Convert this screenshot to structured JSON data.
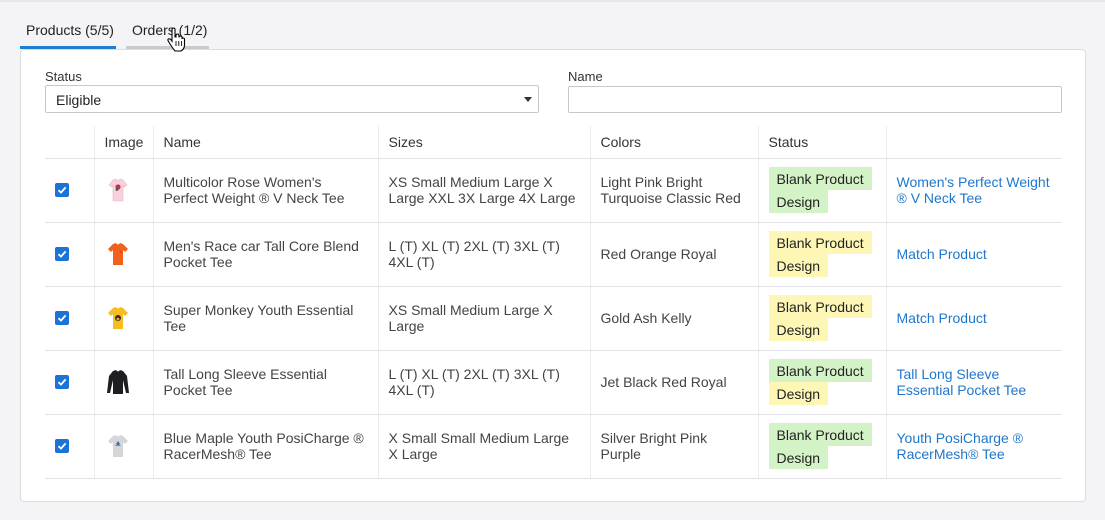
{
  "tabs": [
    {
      "label": "Products (5/5)",
      "active": true
    },
    {
      "label": "Orders (1/2)",
      "active": false
    }
  ],
  "filters": {
    "status_label": "Status",
    "status_value": "Eligible",
    "name_label": "Name",
    "name_value": ""
  },
  "table": {
    "headers": [
      "",
      "Image",
      "Name",
      "Sizes",
      "Colors",
      "Status",
      ""
    ],
    "rows": [
      {
        "checked": true,
        "image": "pink-rose-tee-icon",
        "name": "Multicolor Rose Women's Perfect Weight ® V Neck Tee",
        "sizes": "XS Small Medium Large X Large XXL 3X Large 4X Large",
        "colors": "Light Pink Bright Turquoise Classic Red",
        "status": [
          {
            "text": "Blank Product",
            "color": "#d3f2c6"
          },
          {
            "text": "Design",
            "color": "#d3f2c6"
          }
        ],
        "link": "Women's Perfect Weight ® V Neck Tee"
      },
      {
        "checked": true,
        "image": "orange-tee-icon",
        "name": "Men's Race car Tall Core Blend Pocket Tee",
        "sizes": "L (T) XL (T) 2XL (T) 3XL (T) 4XL (T)",
        "colors": "Red Orange Royal",
        "status": [
          {
            "text": "Blank Product",
            "color": "#fdf6b4"
          },
          {
            "text": "Design",
            "color": "#fdf6b4"
          }
        ],
        "link": "Match Product"
      },
      {
        "checked": true,
        "image": "yellow-monkey-tee-icon",
        "name": "Super Monkey Youth Essential Tee",
        "sizes": "XS Small Medium Large X Large",
        "colors": "Gold Ash Kelly",
        "status": [
          {
            "text": "Blank Product",
            "color": "#fdf6b4"
          },
          {
            "text": "Design",
            "color": "#fdf6b4"
          }
        ],
        "link": "Match Product"
      },
      {
        "checked": true,
        "image": "black-long-sleeve-icon",
        "name": "Tall Long Sleeve Essential Pocket Tee",
        "sizes": "L (T) XL (T) 2XL (T) 3XL (T) 4XL (T)",
        "colors": "Jet Black Red Royal",
        "status": [
          {
            "text": "Blank Product",
            "color": "#d3f2c6"
          },
          {
            "text": "Design",
            "color": "#fdf6b4"
          }
        ],
        "link": "Tall Long Sleeve Essential Pocket Tee"
      },
      {
        "checked": true,
        "image": "gray-maple-tee-icon",
        "name": "Blue Maple Youth PosiCharge ® RacerMesh® Tee",
        "sizes": "X Small Small Medium Large X Large",
        "colors": "Silver Bright Pink Purple",
        "status": [
          {
            "text": "Blank Product",
            "color": "#d3f2c6"
          },
          {
            "text": "Design",
            "color": "#d3f2c6"
          }
        ],
        "link": "Youth PosiCharge ® RacerMesh® Tee"
      }
    ]
  },
  "colors": {
    "accent": "#1f7ecf",
    "checkbox": "#1a73d9",
    "link": "#1f77cc",
    "badge_green": "#d3f2c6",
    "badge_yellow": "#fdf6b4"
  }
}
